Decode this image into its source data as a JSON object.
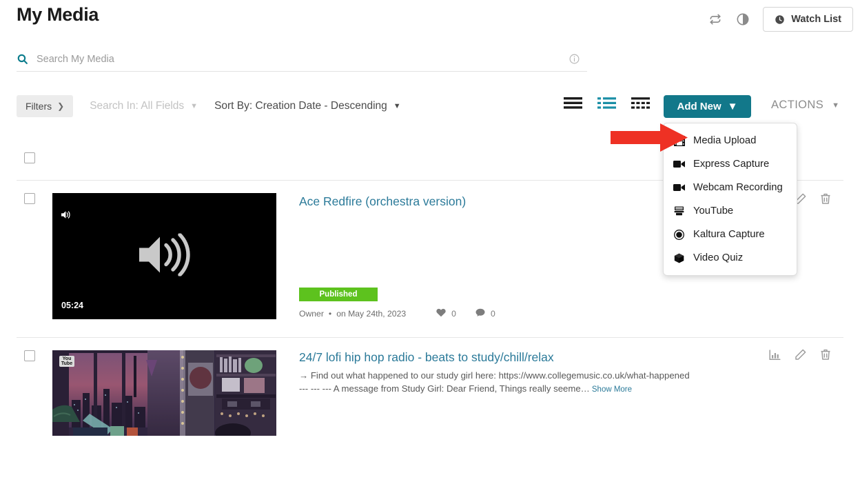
{
  "header": {
    "title": "My Media",
    "refresh_icon": "refresh-sync-icon",
    "contrast_icon": "contrast-half-circle-icon",
    "watch_list_label": "Watch List",
    "watch_list_icon": "clock-icon"
  },
  "search": {
    "placeholder": "Search My Media",
    "value": "",
    "search_icon": "search-icon",
    "info_icon": "info-circle-icon"
  },
  "toolbar": {
    "filters_label": "Filters",
    "filters_chevron": "chevron-right-icon",
    "search_in_label": "Search In: All Fields",
    "sort_by_label": "Sort By: Creation Date - Descending",
    "caret_icon": "chevron-down-icon",
    "views": [
      {
        "name": "compact-list-view",
        "active": false
      },
      {
        "name": "detail-list-view",
        "active": true
      },
      {
        "name": "grid-view",
        "active": false
      }
    ],
    "add_new_label": "Add New",
    "actions_label": "ACTIONS"
  },
  "add_new_menu": {
    "open": true,
    "items": [
      {
        "label": "Media Upload",
        "icon": "film-strip-icon"
      },
      {
        "label": "Express Capture",
        "icon": "video-camera-icon"
      },
      {
        "label": "Webcam Recording",
        "icon": "video-camera-icon"
      },
      {
        "label": "YouTube",
        "icon": "youtube-icon"
      },
      {
        "label": "Kaltura Capture",
        "icon": "record-circle-icon"
      },
      {
        "label": "Video Quiz",
        "icon": "cube-icon"
      }
    ]
  },
  "annotation": {
    "arrow": "red-arrow-pointing-right",
    "arrow_color": "#ee3124",
    "points_at": "Media Upload"
  },
  "list": {
    "select_all_checked": false,
    "items": [
      {
        "title": "Ace Redfire (orchestra version)",
        "description": "",
        "thumbnail_type": "audio",
        "thumbnail_icon": "speaker-volume-icon",
        "duration": "05:24",
        "status": "Published",
        "status_color": "#5dc21e",
        "owner": "Owner",
        "separator": "•",
        "date": "on May 24th, 2023",
        "likes": "0",
        "comments": "0",
        "checked": false,
        "actions": [
          {
            "name": "analytics-icon",
            "label": "Analytics"
          },
          {
            "name": "edit-pencil-icon",
            "label": "Edit"
          },
          {
            "name": "delete-trash-icon",
            "label": "Delete"
          }
        ]
      },
      {
        "title": "24/7 lofi hip hop radio - beats to study/chill/relax",
        "description": "→ Find out what happened to our study girl here: https://www.collegemusic.co.uk/what-happened --- --- --- A message from Study Girl: Dear Friend, Things really seeme…",
        "show_more_label": "Show More",
        "thumbnail_type": "video",
        "thumbnail_badge": "youtube-icon",
        "duration": "",
        "status": "",
        "owner": "",
        "date": "",
        "likes": "",
        "comments": "",
        "checked": false,
        "actions": [
          {
            "name": "analytics-icon",
            "label": "Analytics"
          },
          {
            "name": "edit-pencil-icon",
            "label": "Edit"
          },
          {
            "name": "delete-trash-icon",
            "label": "Delete"
          }
        ]
      }
    ]
  },
  "colors": {
    "accent_teal": "#12788a",
    "link_teal": "#2b7a99",
    "published_green": "#5dc21e",
    "annotation_red": "#ee3124"
  }
}
